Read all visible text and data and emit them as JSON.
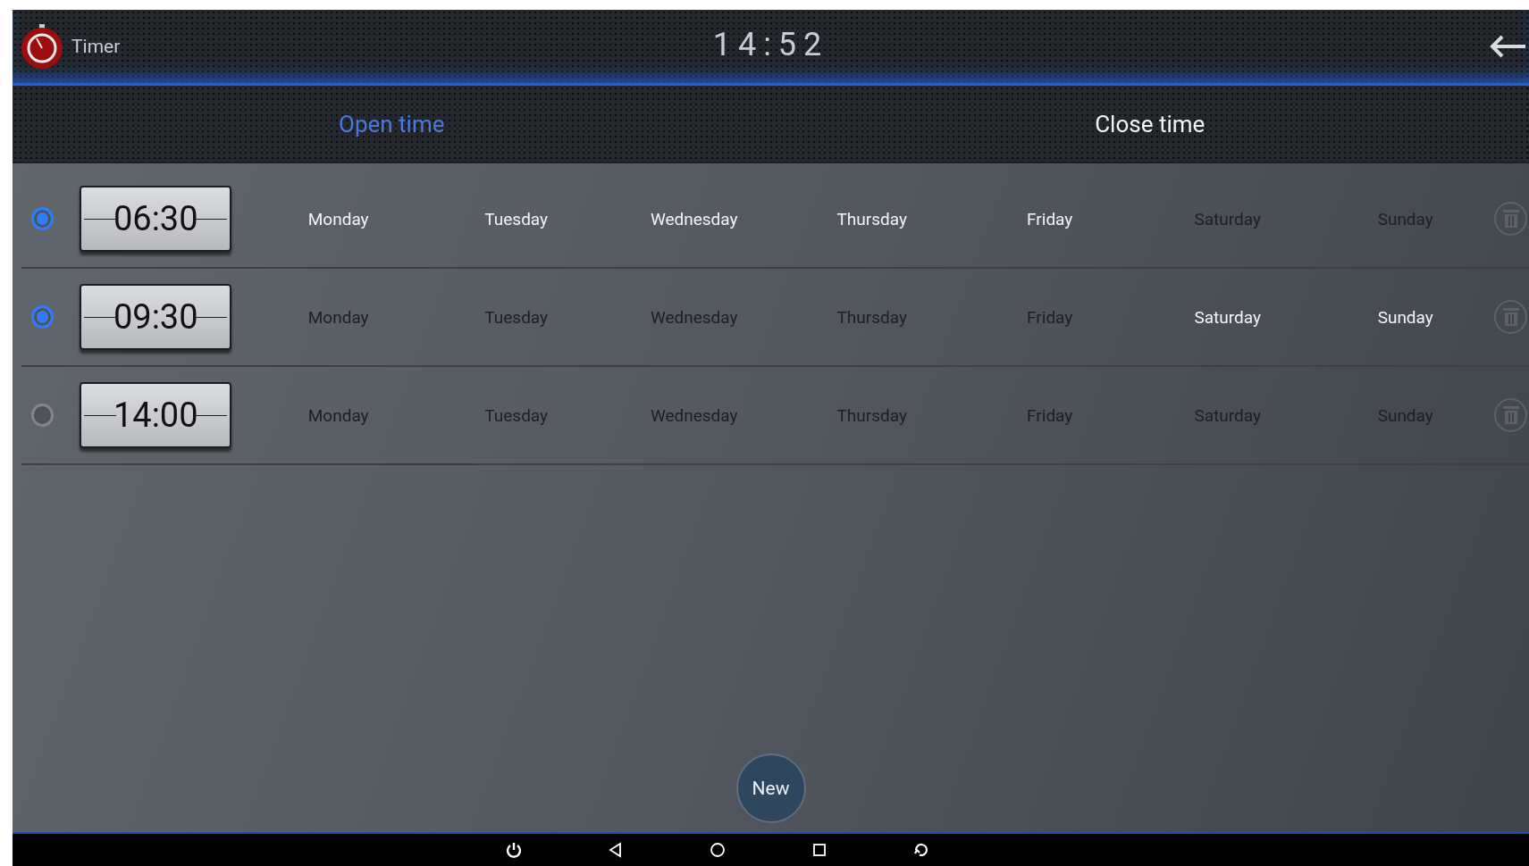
{
  "header": {
    "title": "Timer",
    "clock": "14:52"
  },
  "tabs": [
    {
      "label": "Open time",
      "selected": true
    },
    {
      "label": "Close time",
      "selected": false
    }
  ],
  "schedules": [
    {
      "enabled": true,
      "time": "06:30",
      "days": [
        {
          "label": "Monday",
          "active": true
        },
        {
          "label": "Tuesday",
          "active": true
        },
        {
          "label": "Wednesday",
          "active": true
        },
        {
          "label": "Thursday",
          "active": true
        },
        {
          "label": "Friday",
          "active": true
        },
        {
          "label": "Saturday",
          "active": false
        },
        {
          "label": "Sunday",
          "active": false
        }
      ]
    },
    {
      "enabled": true,
      "time": "09:30",
      "days": [
        {
          "label": "Monday",
          "active": false
        },
        {
          "label": "Tuesday",
          "active": false
        },
        {
          "label": "Wednesday",
          "active": false
        },
        {
          "label": "Thursday",
          "active": false
        },
        {
          "label": "Friday",
          "active": false
        },
        {
          "label": "Saturday",
          "active": true
        },
        {
          "label": "Sunday",
          "active": true
        }
      ]
    },
    {
      "enabled": false,
      "time": "14:00",
      "days": [
        {
          "label": "Monday",
          "active": false
        },
        {
          "label": "Tuesday",
          "active": false
        },
        {
          "label": "Wednesday",
          "active": false
        },
        {
          "label": "Thursday",
          "active": false
        },
        {
          "label": "Friday",
          "active": false
        },
        {
          "label": "Saturday",
          "active": false
        },
        {
          "label": "Sunday",
          "active": false
        }
      ]
    }
  ],
  "new_button": "New"
}
